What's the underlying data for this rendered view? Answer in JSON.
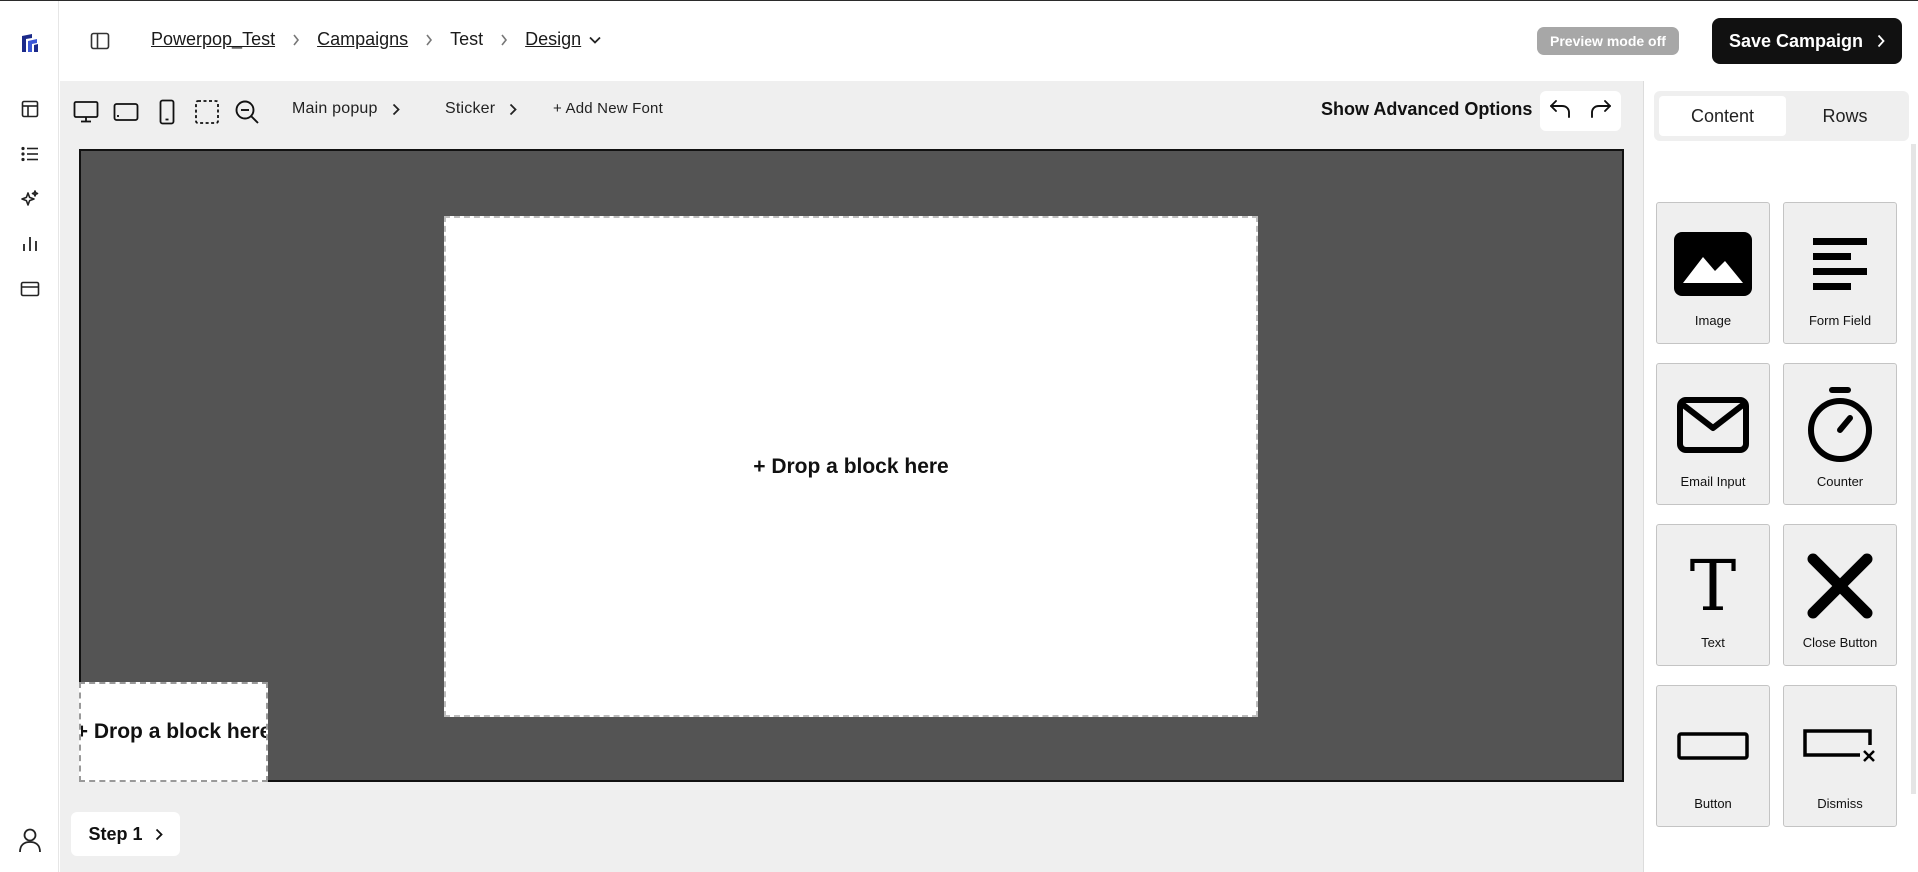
{
  "breadcrumb": {
    "workspace": "Powerpop_Test",
    "campaigns": "Campaigns",
    "campaign": "Test",
    "stage": "Design"
  },
  "header": {
    "preview_badge": "Preview mode off",
    "save_label": "Save Campaign"
  },
  "toolbar": {
    "main_popup": "Main popup",
    "sticker": "Sticker",
    "add_font": "+ Add New Font",
    "advanced": "Show Advanced Options"
  },
  "canvas": {
    "main_drop": "+ Drop a block here",
    "sticker_drop": "+ Drop a block here"
  },
  "footer": {
    "step_label": "Step 1"
  },
  "panel": {
    "tabs": [
      "Content",
      "Rows"
    ],
    "blocks": [
      "Image",
      "Form Field",
      "Email Input",
      "Counter",
      "Text",
      "Close Button",
      "Button",
      "Dismiss"
    ]
  },
  "icons": {
    "rail": [
      "logo-icon",
      "layout-icon",
      "list-icon",
      "sparkles-icon",
      "bar-chart-icon",
      "card-icon",
      "user-icon"
    ]
  }
}
